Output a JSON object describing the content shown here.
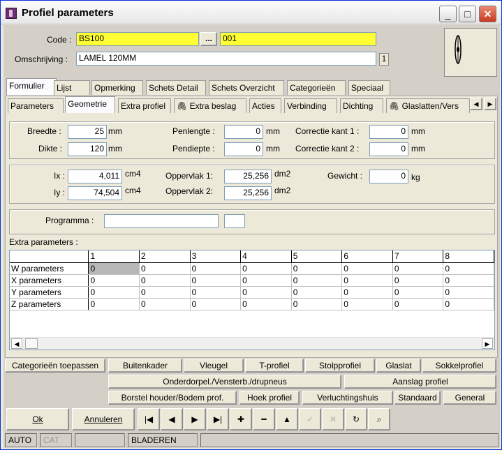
{
  "window": {
    "title": "Profiel parameters"
  },
  "header": {
    "code_label": "Code :",
    "code_value": "BS100",
    "browse_label": "...",
    "code2_value": "001",
    "omschrijving_label": "Omschrijving :",
    "omschrijving_value": "LAMEL 120MM",
    "badge": "1"
  },
  "main_tabs": [
    "Formulier",
    "Lijst",
    "Opmerking",
    "Schets Detail",
    "Schets Overzicht",
    "Categorieën",
    "Speciaal"
  ],
  "sub_tabs": [
    "Parameters",
    "Geometrie",
    "Extra profiel",
    "Extra beslag",
    "Acties",
    "Verbinding",
    "Dichting",
    "Glaslatten/Vers"
  ],
  "geometry": {
    "breedte_label": "Breedte :",
    "breedte_value": "25",
    "breedte_unit": "mm",
    "dikte_label": "Dikte :",
    "dikte_value": "120",
    "dikte_unit": "mm",
    "penlengte_label": "Penlengte :",
    "penlengte_value": "0",
    "penlengte_unit": "mm",
    "pendiepte_label": "Pendiepte :",
    "pendiepte_value": "0",
    "pendiepte_unit": "mm",
    "correctie1_label": "Correctie kant 1 :",
    "correctie1_value": "0",
    "correctie1_unit": "mm",
    "correctie2_label": "Correctie kant 2 :",
    "correctie2_value": "0",
    "correctie2_unit": "mm",
    "ix_label": "Ix :",
    "ix_value": "4,011",
    "ix_unit": "cm4",
    "iy_label": "Iy :",
    "iy_value": "74,504",
    "iy_unit": "cm4",
    "opp1_label": "Oppervlak 1:",
    "opp1_value": "25,256",
    "opp1_unit": "dm2",
    "opp2_label": "Oppervlak 2:",
    "opp2_value": "25,256",
    "opp2_unit": "dm2",
    "gewicht_label": "Gewicht :",
    "gewicht_value": "0",
    "gewicht_unit": "kg",
    "programma_label": "Programma :",
    "programma_value": ""
  },
  "extra": {
    "label": "Extra parameters :",
    "columns": [
      "1",
      "2",
      "3",
      "4",
      "5",
      "6",
      "7",
      "8"
    ],
    "rows": [
      {
        "name": "W parameters",
        "values": [
          "0",
          "0",
          "0",
          "0",
          "0",
          "0",
          "0",
          "0"
        ]
      },
      {
        "name": "X parameters",
        "values": [
          "0",
          "0",
          "0",
          "0",
          "0",
          "0",
          "0",
          "0"
        ]
      },
      {
        "name": "Y parameters",
        "values": [
          "0",
          "0",
          "0",
          "0",
          "0",
          "0",
          "0",
          "0"
        ]
      },
      {
        "name": "Z parameters",
        "values": [
          "0",
          "0",
          "0",
          "0",
          "0",
          "0",
          "0",
          "0"
        ]
      }
    ]
  },
  "actions": {
    "row1": [
      "Categorieën toepassen",
      "Buitenkader",
      "Vleugel",
      "T-profiel",
      "Stolpprofiel",
      "Glaslat",
      "Sokkelprofiel"
    ],
    "row2": [
      "Onderdorpel./Vensterb./drupneus",
      "Aanslag profiel"
    ],
    "row3": [
      "Borstel houder/Bodem prof.",
      "Hoek profiel",
      "Verluchtingshuis",
      "Standaard",
      "General"
    ]
  },
  "footer": {
    "ok": "Ok",
    "annuleren": "Annuleren"
  },
  "nav_icons": [
    "first-icon",
    "prev-icon",
    "next-icon",
    "last-icon",
    "add-icon",
    "remove-icon",
    "up-icon",
    "confirm-icon",
    "cancel-icon",
    "refresh-icon",
    "search-icon"
  ],
  "status": {
    "auto": "AUTO",
    "cat": "CAT",
    "mode": "BLADEREN"
  }
}
